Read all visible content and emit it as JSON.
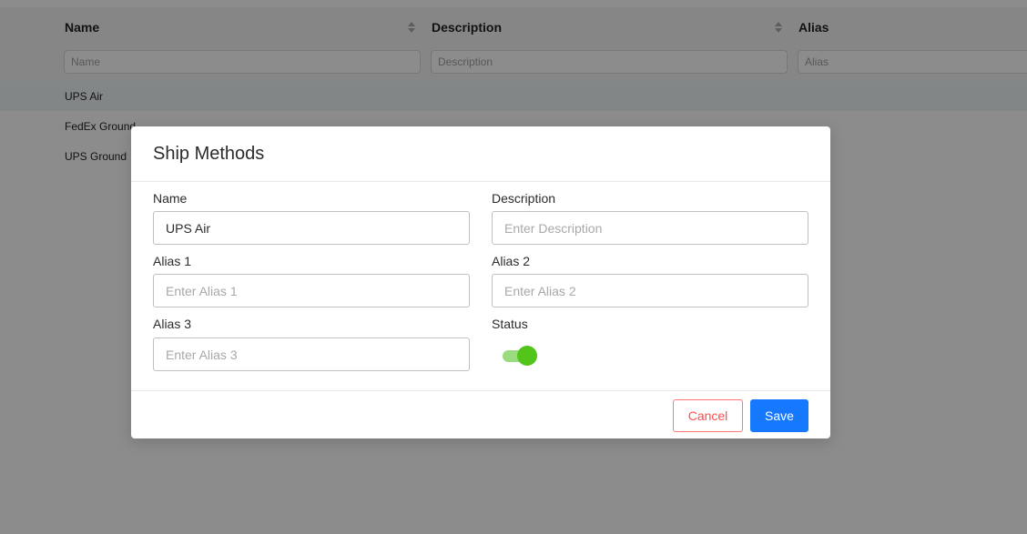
{
  "table": {
    "columns": [
      {
        "label": "Name",
        "filter_placeholder": "Name"
      },
      {
        "label": "Description",
        "filter_placeholder": "Description"
      },
      {
        "label": "Alias",
        "filter_placeholder": "Alias"
      }
    ],
    "rows": [
      {
        "name": "UPS Air"
      },
      {
        "name": "FedEx Ground"
      },
      {
        "name": "UPS Ground"
      }
    ]
  },
  "modal": {
    "title": "Ship Methods",
    "fields": {
      "name": {
        "label": "Name",
        "value": "UPS Air",
        "placeholder": ""
      },
      "description": {
        "label": "Description",
        "value": "",
        "placeholder": "Enter Description"
      },
      "alias1": {
        "label": "Alias 1",
        "value": "",
        "placeholder": "Enter Alias 1"
      },
      "alias2": {
        "label": "Alias 2",
        "value": "",
        "placeholder": "Enter Alias 2"
      },
      "alias3": {
        "label": "Alias 3",
        "value": "",
        "placeholder": "Enter Alias 3"
      },
      "status": {
        "label": "Status",
        "on": true
      }
    },
    "buttons": {
      "cancel": "Cancel",
      "save": "Save"
    }
  },
  "colors": {
    "primary": "#1677ff",
    "danger": "#ff4d4f",
    "toggle_on": "#52c41a"
  }
}
